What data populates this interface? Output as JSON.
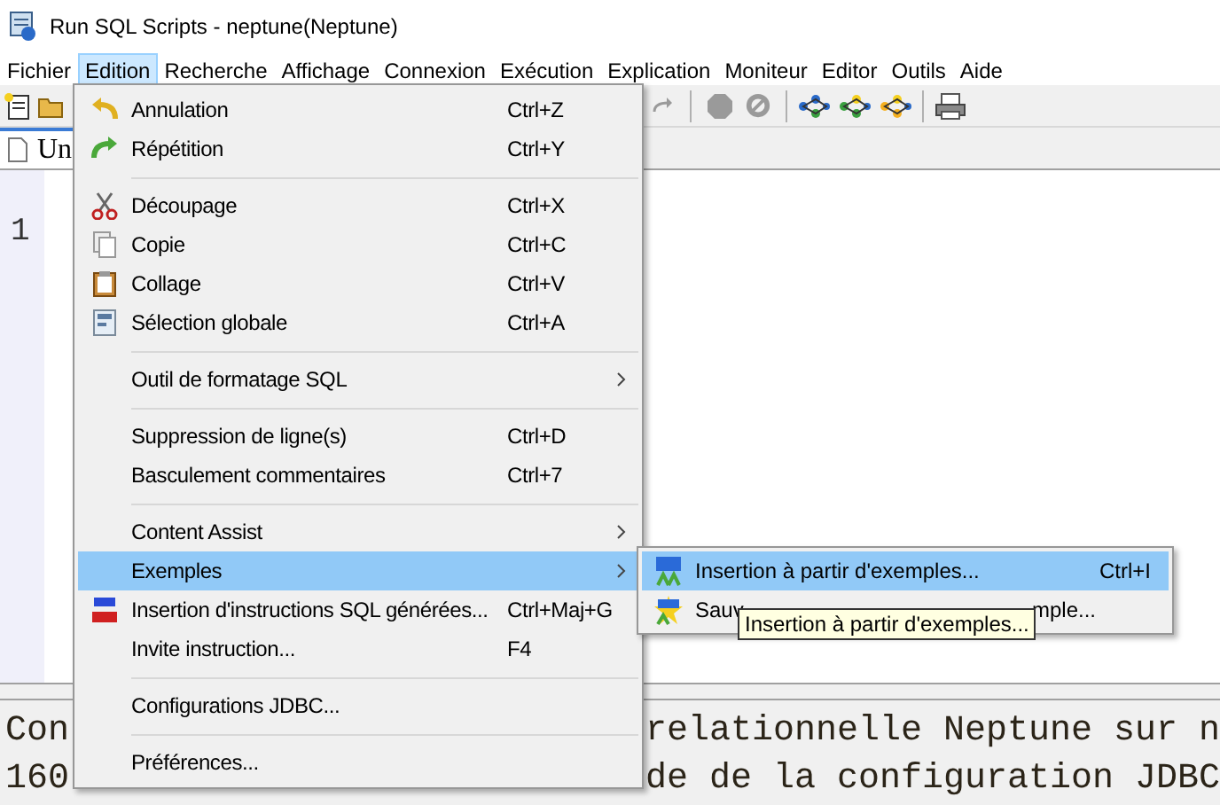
{
  "window": {
    "title": "Run SQL Scripts - neptune(Neptune)"
  },
  "menu_bar": [
    {
      "label": "Fichier",
      "selected": false
    },
    {
      "label": "Edition",
      "selected": true
    },
    {
      "label": "Recherche",
      "selected": false
    },
    {
      "label": "Affichage",
      "selected": false
    },
    {
      "label": "Connexion",
      "selected": false
    },
    {
      "label": "Exécution",
      "selected": false
    },
    {
      "label": "Explication",
      "selected": false
    },
    {
      "label": "Moniteur",
      "selected": false
    },
    {
      "label": "Editor",
      "selected": false
    },
    {
      "label": "Outils",
      "selected": false
    },
    {
      "label": "Aide",
      "selected": false
    }
  ],
  "editor": {
    "tab_label": "Un",
    "line_number": "1"
  },
  "messages": [
    {
      "start": "Con",
      "end": "relationnelle Neptune sur n"
    },
    {
      "start": "160",
      "end": "de de la configuration JDBC"
    }
  ],
  "edit_menu": [
    {
      "kind": "item",
      "label": "Annulation",
      "shortcut": "Ctrl+Z",
      "selected": false,
      "submenu": false
    },
    {
      "kind": "item",
      "label": "Répétition",
      "shortcut": "Ctrl+Y",
      "selected": false,
      "submenu": false
    },
    {
      "kind": "separator"
    },
    {
      "kind": "item",
      "label": "Découpage",
      "shortcut": "Ctrl+X",
      "selected": false,
      "submenu": false
    },
    {
      "kind": "item",
      "label": "Copie",
      "shortcut": "Ctrl+C",
      "selected": false,
      "submenu": false
    },
    {
      "kind": "item",
      "label": "Collage",
      "shortcut": "Ctrl+V",
      "selected": false,
      "submenu": false
    },
    {
      "kind": "item",
      "label": "Sélection globale",
      "shortcut": "Ctrl+A",
      "selected": false,
      "submenu": false
    },
    {
      "kind": "separator"
    },
    {
      "kind": "item",
      "label": "Outil de formatage SQL",
      "selected": false,
      "submenu": true
    },
    {
      "kind": "separator"
    },
    {
      "kind": "item",
      "label": "Suppression de ligne(s)",
      "shortcut": "Ctrl+D",
      "selected": false,
      "submenu": false
    },
    {
      "kind": "item",
      "label": "Basculement commentaires",
      "shortcut": "Ctrl+7",
      "selected": false,
      "submenu": false
    },
    {
      "kind": "separator"
    },
    {
      "kind": "item",
      "label": "Content Assist",
      "selected": false,
      "submenu": true
    },
    {
      "kind": "item",
      "label": "Exemples",
      "selected": true,
      "submenu": true
    },
    {
      "kind": "item",
      "label": "Insertion d'instructions SQL générées...",
      "shortcut": "Ctrl+Maj+G",
      "selected": false,
      "submenu": false
    },
    {
      "kind": "item",
      "label": "Invite instruction...",
      "shortcut": "F4",
      "selected": false,
      "submenu": false
    },
    {
      "kind": "separator"
    },
    {
      "kind": "item",
      "label": "Configurations JDBC...",
      "selected": false,
      "submenu": false
    },
    {
      "kind": "separator"
    },
    {
      "kind": "item",
      "label": "Préférences...",
      "selected": false,
      "submenu": false
    }
  ],
  "examples_submenu": [
    {
      "label": "Insertion à partir d'exemples...",
      "shortcut": "Ctrl+I",
      "selected": true
    },
    {
      "label_start": "Sauv",
      "label_end": "mple...",
      "selected": false
    }
  ],
  "tooltip": "Insertion à partir d'exemples..."
}
